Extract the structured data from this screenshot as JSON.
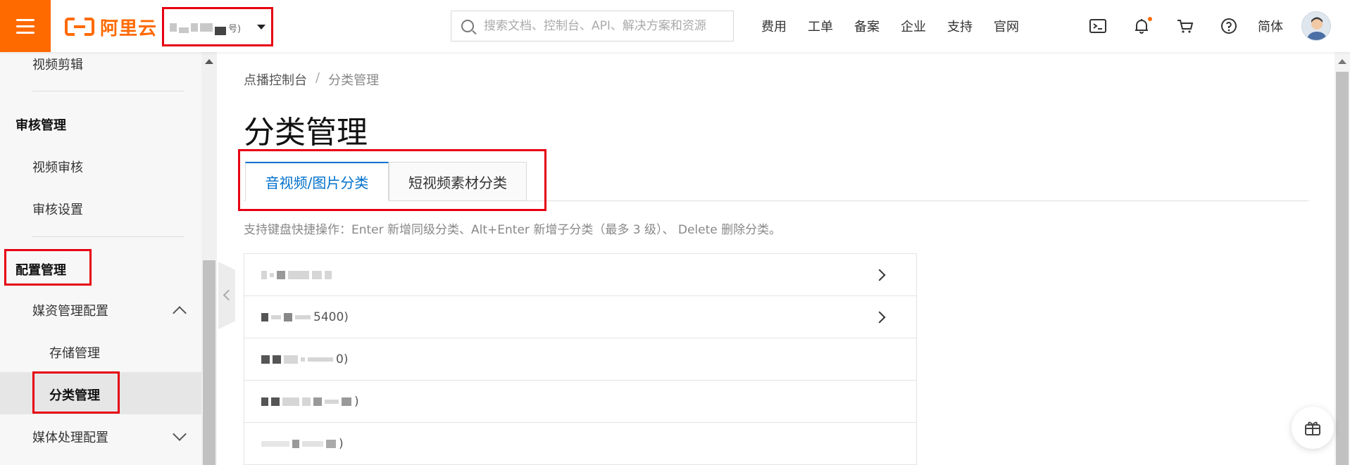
{
  "topbar": {
    "logo_text": "阿里云",
    "account_suffix": "号)",
    "search_placeholder": "搜索文档、控制台、API、解决方案和资源",
    "nav": [
      "费用",
      "工单",
      "备案",
      "企业",
      "支持",
      "官网"
    ],
    "lang": "简体"
  },
  "sidebar": {
    "video_edit": "视频剪辑",
    "group_audit": "审核管理",
    "video_audit": "视频审核",
    "audit_settings": "审核设置",
    "group_config": "配置管理",
    "media_config": "媒资管理配置",
    "storage": "存储管理",
    "category": "分类管理",
    "media_processing": "媒体处理配置"
  },
  "main": {
    "breadcrumb": [
      "点播控制台",
      "分类管理"
    ],
    "breadcrumb_sep": "/",
    "title": "分类管理",
    "tabs": [
      {
        "label": "音视频/图片分类",
        "active": true
      },
      {
        "label": "短视频素材分类",
        "active": false
      }
    ],
    "hint": "支持键盘快捷操作：Enter 新增同级分类、Alt+Enter 新增子分类（最多 3 级）、 Delete 删除分类。",
    "rows": [
      {
        "suffix": "",
        "has_children": true
      },
      {
        "suffix": "5400)",
        "has_children": true
      },
      {
        "suffix": "0)",
        "has_children": false
      },
      {
        "suffix": ")",
        "has_children": false
      },
      {
        "suffix": ")",
        "has_children": false
      }
    ]
  },
  "colors": {
    "brand": "#ff6a00",
    "highlight": "#e60012",
    "tab_active": "#0070cc"
  }
}
